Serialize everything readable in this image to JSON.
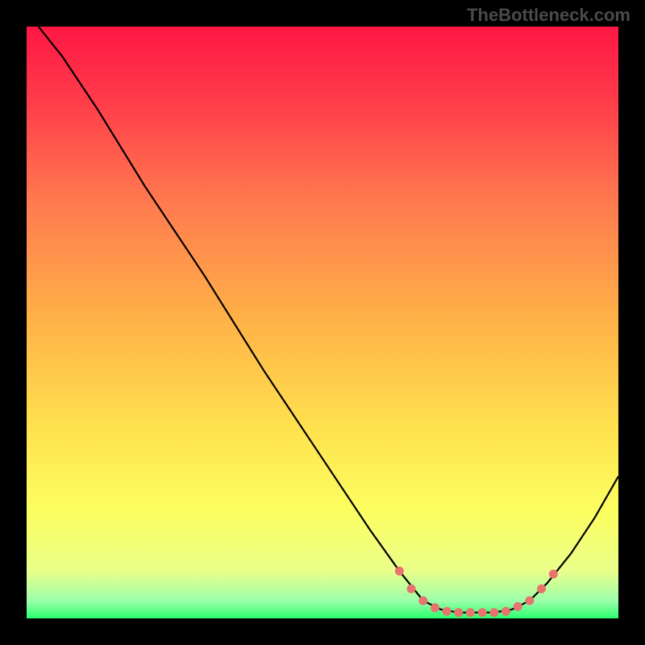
{
  "watermark": "TheBottleneck.com",
  "chart_data": {
    "type": "line",
    "title": "",
    "xlabel": "",
    "ylabel": "",
    "xlim": [
      0,
      100
    ],
    "ylim": [
      0,
      100
    ],
    "gradient_stops": [
      {
        "offset": 0,
        "color": "#ff1744"
      },
      {
        "offset": 12,
        "color": "#ff3a4a"
      },
      {
        "offset": 30,
        "color": "#ff7b4f"
      },
      {
        "offset": 50,
        "color": "#ffb347"
      },
      {
        "offset": 68,
        "color": "#ffe24f"
      },
      {
        "offset": 82,
        "color": "#fcff60"
      },
      {
        "offset": 92,
        "color": "#eaff8a"
      },
      {
        "offset": 97,
        "color": "#9dffaa"
      },
      {
        "offset": 100,
        "color": "#2bff6e"
      }
    ],
    "series": [
      {
        "name": "curve",
        "color": "#000000",
        "points": [
          {
            "x": 2,
            "y": 100
          },
          {
            "x": 6,
            "y": 95
          },
          {
            "x": 12,
            "y": 86
          },
          {
            "x": 20,
            "y": 73
          },
          {
            "x": 30,
            "y": 58
          },
          {
            "x": 40,
            "y": 42
          },
          {
            "x": 50,
            "y": 27
          },
          {
            "x": 58,
            "y": 15
          },
          {
            "x": 63,
            "y": 8
          },
          {
            "x": 67,
            "y": 3
          },
          {
            "x": 70,
            "y": 1.5
          },
          {
            "x": 73,
            "y": 1
          },
          {
            "x": 76,
            "y": 1
          },
          {
            "x": 79,
            "y": 1
          },
          {
            "x": 82,
            "y": 1.5
          },
          {
            "x": 85,
            "y": 3
          },
          {
            "x": 88,
            "y": 6
          },
          {
            "x": 92,
            "y": 11
          },
          {
            "x": 96,
            "y": 17
          },
          {
            "x": 100,
            "y": 24
          }
        ]
      }
    ],
    "markers": {
      "name": "dots",
      "color": "#e8736f",
      "points": [
        {
          "x": 63,
          "y": 8
        },
        {
          "x": 65,
          "y": 5
        },
        {
          "x": 67,
          "y": 3
        },
        {
          "x": 69,
          "y": 1.8
        },
        {
          "x": 71,
          "y": 1.2
        },
        {
          "x": 73,
          "y": 1
        },
        {
          "x": 75,
          "y": 1
        },
        {
          "x": 77,
          "y": 1
        },
        {
          "x": 79,
          "y": 1
        },
        {
          "x": 81,
          "y": 1.2
        },
        {
          "x": 83,
          "y": 2
        },
        {
          "x": 85,
          "y": 3
        },
        {
          "x": 87,
          "y": 5
        },
        {
          "x": 89,
          "y": 7.5
        }
      ]
    }
  }
}
